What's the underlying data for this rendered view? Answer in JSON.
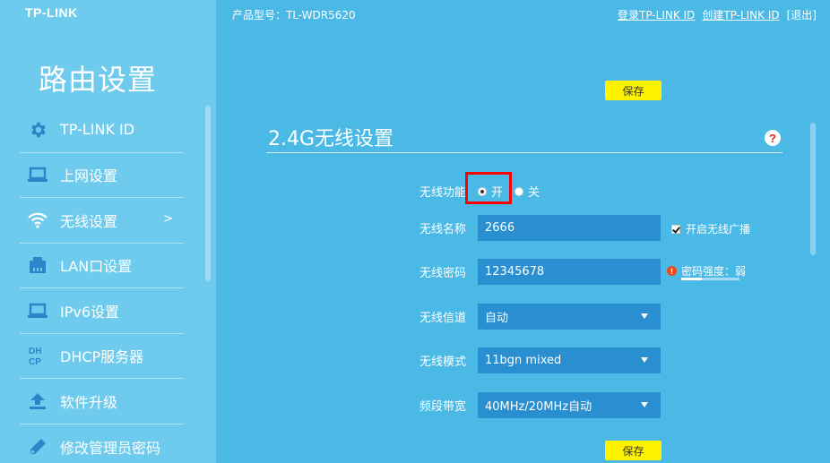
{
  "brand": {
    "logo": "TP-LINK"
  },
  "sidebar": {
    "title": "路由设置",
    "items": [
      {
        "label": "TP-LINK ID",
        "icon": "gear-icon"
      },
      {
        "label": "上网设置",
        "icon": "laptop-icon"
      },
      {
        "label": "无线设置",
        "icon": "wifi-icon",
        "arrow": ">"
      },
      {
        "label": "LAN口设置",
        "icon": "network-icon"
      },
      {
        "label": "IPv6设置",
        "icon": "laptop-icon"
      },
      {
        "label": "DHCP服务器",
        "icon": "dhcp-icon",
        "icon_text": "DH\nCP"
      },
      {
        "label": "软件升级",
        "icon": "upload-icon"
      },
      {
        "label": "修改管理员密码",
        "icon": "pencil-icon"
      }
    ]
  },
  "header": {
    "model": "产品型号：TL-WDR5620",
    "login": "登录TP-LINK ID",
    "create": "创建TP-LINK ID",
    "logout": "[退出]"
  },
  "buttons": {
    "save": "保存"
  },
  "section": {
    "title": "2.4G无线设置",
    "help": "?"
  },
  "form": {
    "wireless_function": {
      "label": "无线功能",
      "on": "开",
      "off": "关",
      "selected": "on"
    },
    "ssid": {
      "label": "无线名称",
      "value": "2666"
    },
    "broadcast": {
      "label": "开启无线广播",
      "checked": true
    },
    "password": {
      "label": "无线密码",
      "value": "12345678"
    },
    "strength": {
      "text": "密码强度：弱",
      "level": 0.35,
      "icon": "!"
    },
    "channel": {
      "label": "无线信道",
      "value": "自动"
    },
    "mode": {
      "label": "无线模式",
      "value": "11bgn mixed"
    },
    "bandwidth": {
      "label": "频段带宽",
      "value": "40MHz/20MHz自动"
    }
  },
  "colors": {
    "background": "#4bb9e6",
    "sidebar": "#6fcbee",
    "field": "#2a8fd0",
    "save_button": "#fff200",
    "highlight": "#ff0000"
  }
}
